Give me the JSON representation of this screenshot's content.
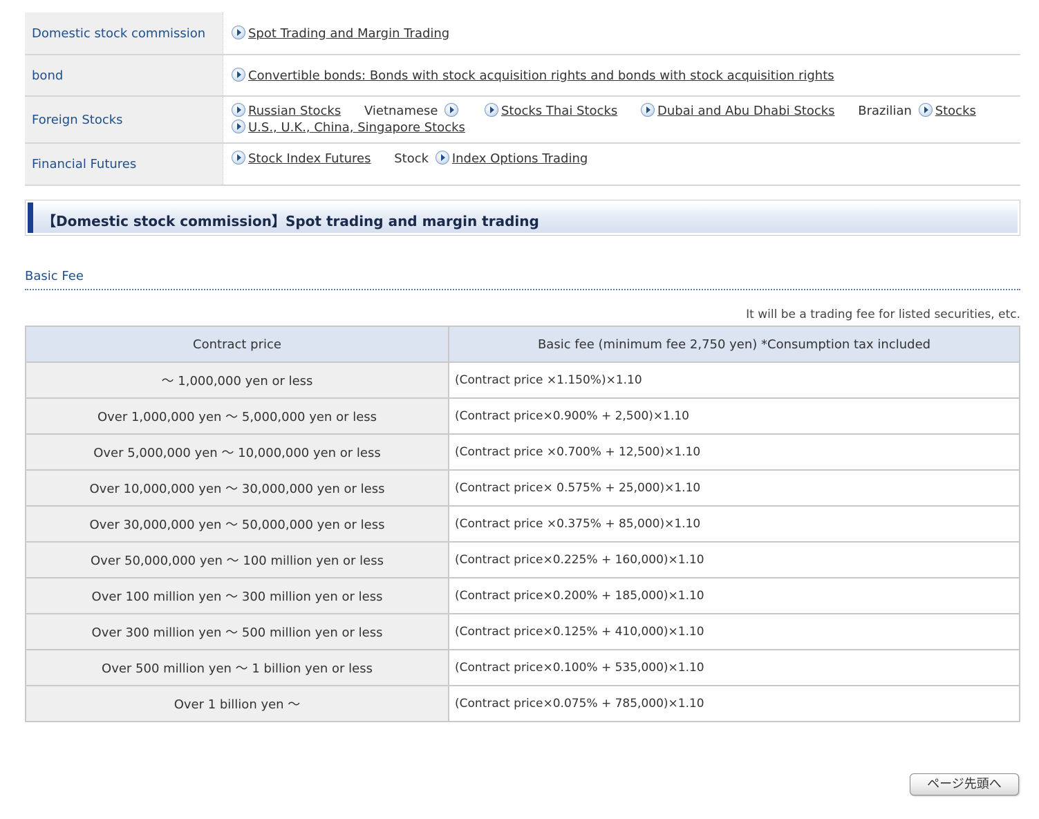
{
  "nav": {
    "rows": [
      {
        "label": "Domestic stock commission",
        "items": [
          {
            "type": "link",
            "text": "Spot Trading and Margin Trading"
          }
        ]
      },
      {
        "label": "bond",
        "items": [
          {
            "type": "link",
            "text": "Convertible bonds: Bonds with stock acquisition rights and bonds with stock acquisition rights"
          }
        ]
      },
      {
        "label": "Foreign Stocks"
      },
      {
        "label": "Financial Futures"
      }
    ],
    "foreign": {
      "russian": "Russian Stocks",
      "vietnamese": "Vietnamese",
      "thai": "Stocks Thai Stocks",
      "dubai": "Dubai and Abu Dhabi Stocks",
      "brazilian": "Brazilian",
      "stocks": "Stocks",
      "us": "U.S., U.K., China, Singapore Stocks"
    },
    "futures": {
      "index_futures": "Stock Index Futures",
      "stock": "Stock",
      "options": "Index Options Trading"
    }
  },
  "section": {
    "title": "【Domestic stock commission】Spot trading and margin trading"
  },
  "basic_fee": {
    "heading": "Basic Fee",
    "note": "It will be a trading fee for listed securities, etc.",
    "columns": [
      "Contract price",
      "Basic fee (minimum fee 2,750 yen) *Consumption tax included"
    ],
    "rows": [
      {
        "price": "～ 1,000,000 yen or less",
        "formula": "(Contract price ×1.150%)×1.10"
      },
      {
        "price": "Over 1,000,000 yen ～ 5,000,000 yen or less",
        "formula": "(Contract price×0.900% + 2,500)×1.10"
      },
      {
        "price": "Over 5,000,000 yen ～ 10,000,000 yen or less",
        "formula": "(Contract price ×0.700% + 12,500)×1.10"
      },
      {
        "price": "Over 10,000,000 yen ～ 30,000,000 yen or less",
        "formula": "(Contract price× 0.575% + 25,000)×1.10"
      },
      {
        "price": "Over 30,000,000 yen ～ 50,000,000 yen or less",
        "formula": "(Contract price ×0.375% + 85,000)×1.10"
      },
      {
        "price": "Over 50,000,000 yen ～ 100 million yen or less",
        "formula": "(Contract price×0.225% + 160,000)×1.10"
      },
      {
        "price": "Over 100 million yen ～ 300 million yen or less",
        "formula": "(Contract price×0.200% + 185,000)×1.10"
      },
      {
        "price": "Over 300 million yen ～ 500 million yen or less",
        "formula": "(Contract price×0.125% + 410,000)×1.10"
      },
      {
        "price": "Over 500 million yen ～ 1 billion yen or less",
        "formula": "(Contract price×0.100% + 535,000)×1.10"
      },
      {
        "price": "Over 1 billion yen ～",
        "formula": "(Contract price×0.075% + 785,000)×1.10"
      }
    ]
  },
  "page_top_button": "ページ先頭へ"
}
